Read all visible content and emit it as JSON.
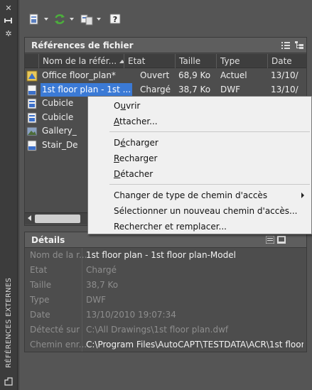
{
  "palette": {
    "title": "RÉFÉRENCES EXTERNES"
  },
  "file_refs": {
    "title": "Références de fichier",
    "columns": [
      "Nom de la référ...",
      "Etat",
      "Taille",
      "Type",
      "Date"
    ],
    "rows": [
      {
        "icon": "dwg-drawing-icon",
        "name": "Office floor_plan*",
        "state": "Ouvert",
        "size": "68,9 Ko",
        "type": "Actuel",
        "date": "13/10/"
      },
      {
        "icon": "dwf-file-icon",
        "name": "1st floor plan - 1st ...",
        "state": "Chargé",
        "size": "38,7 Ko",
        "type": "DWF",
        "date": "13/10/",
        "selected": true
      },
      {
        "icon": "dwg-file-icon",
        "name": "Cubicle"
      },
      {
        "icon": "dwg-file-icon",
        "name": "Cubicle"
      },
      {
        "icon": "image-file-icon",
        "name": "Gallery_"
      },
      {
        "icon": "dwf-file-icon",
        "name": "Stair_De"
      }
    ]
  },
  "details": {
    "title": "Détails",
    "rows": [
      {
        "label": "Nom de la r...",
        "value": "1st floor plan - 1st floor plan-Model",
        "bright": true
      },
      {
        "label": "Etat",
        "value": "Chargé"
      },
      {
        "label": "Taille",
        "value": "38,7 Ko"
      },
      {
        "label": "Type",
        "value": "DWF"
      },
      {
        "label": "Date",
        "value": "13/10/2010 19:07:34"
      },
      {
        "label": "Détecté sur",
        "value": "C:\\All Drawings\\1st floor plan.dwf"
      },
      {
        "label": "Chemin enr...",
        "value": "C:\\Program Files\\AutoCAPT\\TESTDATA\\ACR\\1st floor ...",
        "bright": true
      }
    ]
  },
  "context_menu": {
    "items": [
      {
        "pre": "O",
        "u": "u",
        "post": "vrir"
      },
      {
        "pre": "",
        "u": "A",
        "post": "ttacher..."
      },
      {
        "pre": "D",
        "u": "é",
        "post": "charger"
      },
      {
        "pre": "",
        "u": "R",
        "post": "echarger"
      },
      {
        "pre": "",
        "u": "D",
        "post": "étacher"
      },
      {
        "pre": "Changer de type de chemin d'accès",
        "u": "",
        "post": ""
      },
      {
        "pre": "Sélectionner un nouveau chemin d'accès...",
        "u": "",
        "post": ""
      },
      {
        "pre": "Rechercher et remplacer...",
        "u": "",
        "post": ""
      }
    ]
  },
  "colors": {
    "selection": "#3b7ad6",
    "panel_bg": "#4d4d4d",
    "menu_bg": "#f0f0f0"
  }
}
